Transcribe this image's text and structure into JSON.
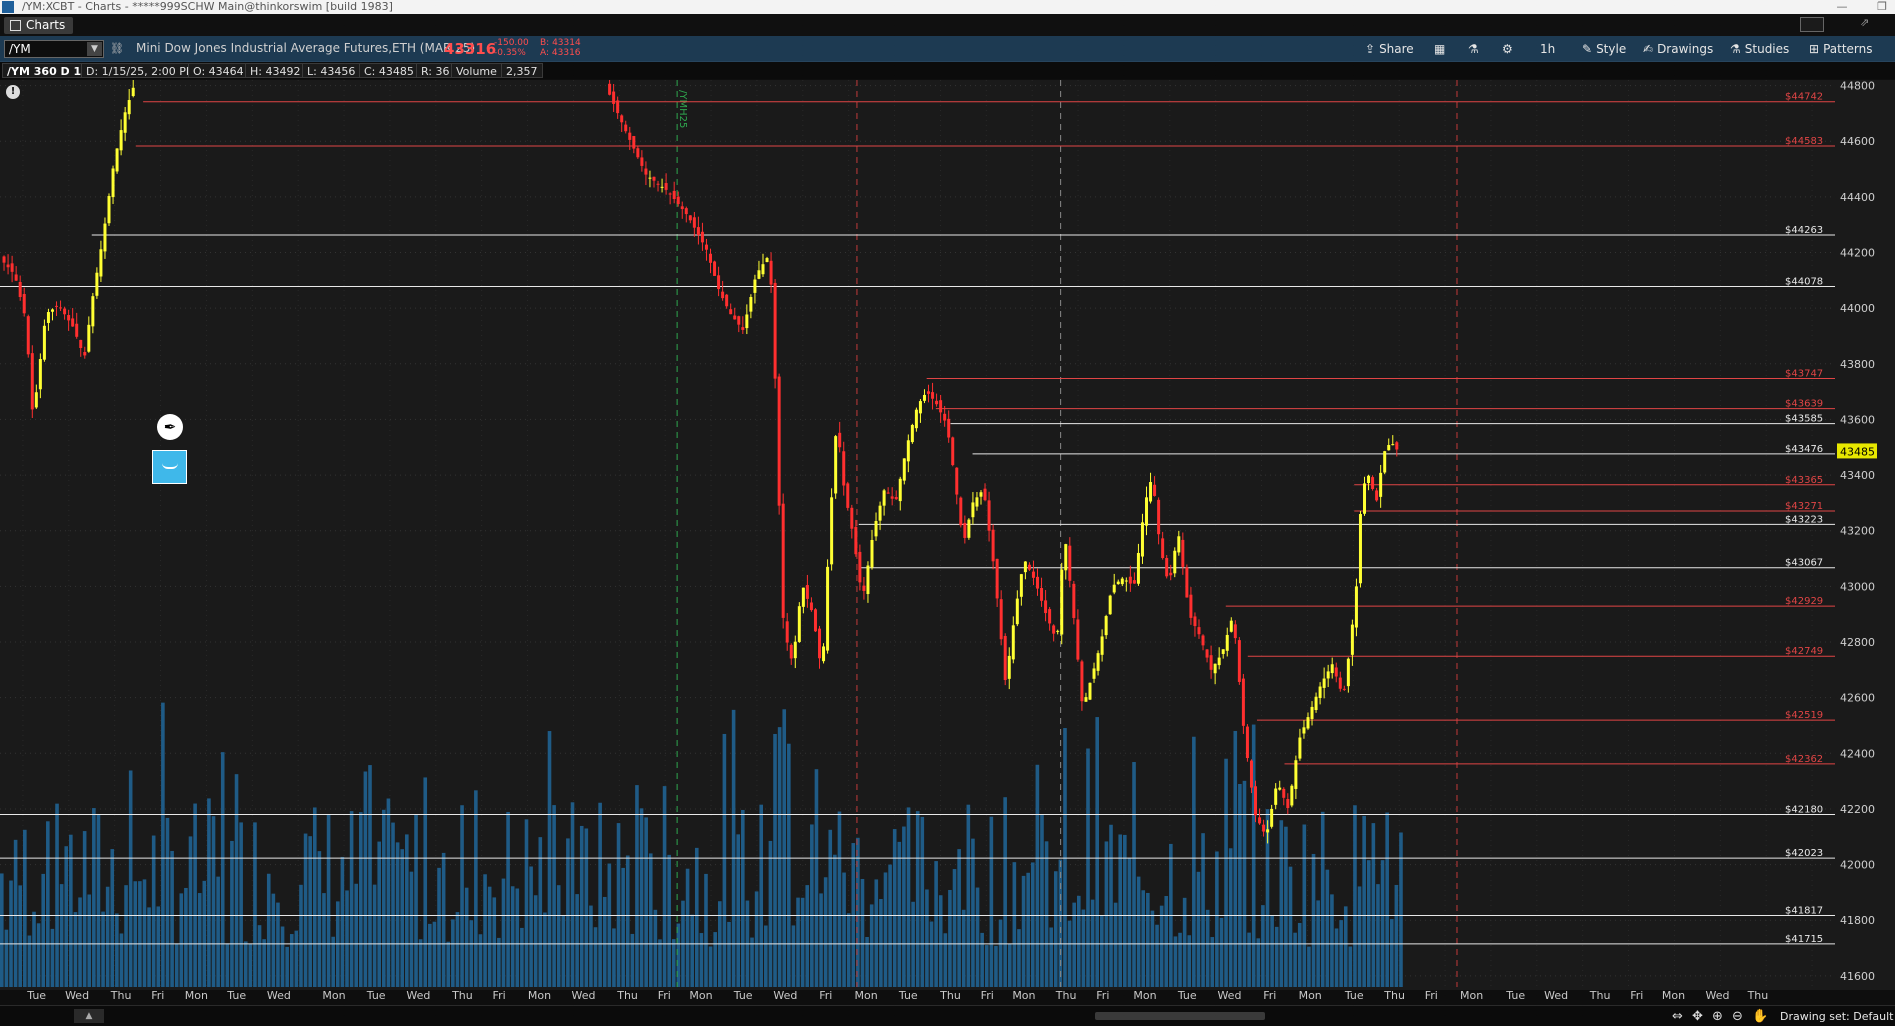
{
  "window": {
    "title": "/YM:XCBT - Charts - *****999SCHW Main@thinkorswim [build 1983]"
  },
  "tabs": [
    {
      "label": "Charts"
    }
  ],
  "toolbar": {
    "symbol": "/YM",
    "instrument_name": "Mini Dow Jones Industrial Average Futures,ETH (MAR 25)",
    "last_price": "43316",
    "net_change": "-150.00",
    "net_change_pct": "-0.35%",
    "bid": "B: 43314",
    "ask": "A: 43316",
    "buttons": [
      {
        "label": "Share",
        "icon": "share-icon"
      },
      {
        "label": "",
        "icon": "grid-icon"
      },
      {
        "label": "",
        "icon": "flask-icon"
      },
      {
        "label": "",
        "icon": "gear-icon"
      },
      {
        "label": "1h",
        "icon": ""
      },
      {
        "label": "Style",
        "icon": "style-icon"
      },
      {
        "label": "Drawings",
        "icon": "drawings-icon"
      },
      {
        "label": "Studies",
        "icon": "studies-icon"
      },
      {
        "label": "Patterns",
        "icon": "patterns-icon"
      }
    ]
  },
  "chart_header": {
    "symbol_period": "/YM 360 D 1h",
    "date": "D: 1/15/25, 2:00 PM",
    "open": "O: 43464",
    "high": "H: 43492",
    "low": "L: 43456",
    "close": "C: 43485",
    "range": "R: 36",
    "volume_label": "Volume",
    "volume_value": "2,357"
  },
  "chart_data": {
    "type": "candlestick",
    "y_range": [
      41560,
      44820
    ],
    "y_ticks": [
      44800,
      44600,
      44400,
      44200,
      44000,
      43800,
      43600,
      43400,
      43200,
      43000,
      42800,
      42600,
      42400,
      42200,
      42000,
      41800,
      41600
    ],
    "current_price_tag": "43485",
    "price_levels": [
      {
        "label": "$44742",
        "value": 44742,
        "color": "#e04545",
        "start": 0.078
      },
      {
        "label": "$44583",
        "value": 44583,
        "color": "#e04545",
        "start": 0.074
      },
      {
        "label": "$44263",
        "value": 44263,
        "color": "#e8e8e8",
        "start": 0.05
      },
      {
        "label": "$44078",
        "value": 44078,
        "color": "#e8e8e8",
        "start": 0.0
      },
      {
        "label": "$43747",
        "value": 43747,
        "color": "#e04545",
        "start": 0.505
      },
      {
        "label": "$43639",
        "value": 43639,
        "color": "#e04545",
        "start": 0.51
      },
      {
        "label": "$43585",
        "value": 43585,
        "color": "#e8e8e8",
        "start": 0.518
      },
      {
        "label": "$43476",
        "value": 43476,
        "color": "#e8e8e8",
        "start": 0.53
      },
      {
        "label": "$43365",
        "value": 43365,
        "color": "#e04545",
        "start": 0.738
      },
      {
        "label": "$43271",
        "value": 43271,
        "color": "#e04545",
        "start": 0.738
      },
      {
        "label": "$43223",
        "value": 43223,
        "color": "#e8e8e8",
        "start": 0.468
      },
      {
        "label": "$43067",
        "value": 43067,
        "color": "#e8e8e8",
        "start": 0.468
      },
      {
        "label": "$42929",
        "value": 42929,
        "color": "#e04545",
        "start": 0.668
      },
      {
        "label": "$42749",
        "value": 42749,
        "color": "#e04545",
        "start": 0.68
      },
      {
        "label": "$42519",
        "value": 42519,
        "color": "#e04545",
        "start": 0.685
      },
      {
        "label": "$42362",
        "value": 42362,
        "color": "#e04545",
        "start": 0.7
      },
      {
        "label": "$42180",
        "value": 42180,
        "color": "#e8e8e8",
        "start": 0.0
      },
      {
        "label": "$42023",
        "value": 42023,
        "color": "#e8e8e8",
        "start": 0.0
      },
      {
        "label": "$41817",
        "value": 41817,
        "color": "#e8e8e8",
        "start": 0.0
      },
      {
        "label": "$41715",
        "value": 41715,
        "color": "#e8e8e8",
        "start": 0.0
      }
    ],
    "vertical_markers": [
      {
        "pos": 0.369,
        "color": "#2fa84f",
        "label": "/YMH25"
      },
      {
        "pos": 0.467,
        "color": "#c03a3a",
        "label": ""
      },
      {
        "pos": 0.578,
        "color": "#8a8a8a",
        "label": ""
      },
      {
        "pos": 0.794,
        "color": "#c03a3a",
        "label": ""
      }
    ],
    "price_path": [
      [
        0.0,
        44180
      ],
      [
        0.008,
        44120
      ],
      [
        0.014,
        43960
      ],
      [
        0.018,
        43600
      ],
      [
        0.025,
        43980
      ],
      [
        0.032,
        44010
      ],
      [
        0.04,
        43930
      ],
      [
        0.046,
        43820
      ],
      [
        0.05,
        44020
      ],
      [
        0.056,
        44250
      ],
      [
        0.062,
        44520
      ],
      [
        0.068,
        44700
      ],
      [
        0.074,
        44820
      ],
      [
        0.33,
        44800
      ],
      [
        0.34,
        44650
      ],
      [
        0.352,
        44480
      ],
      [
        0.364,
        44420
      ],
      [
        0.375,
        44330
      ],
      [
        0.385,
        44210
      ],
      [
        0.392,
        44060
      ],
      [
        0.398,
        43980
      ],
      [
        0.405,
        43920
      ],
      [
        0.412,
        44120
      ],
      [
        0.418,
        44180
      ],
      [
        0.421,
        44050
      ],
      [
        0.424,
        43400
      ],
      [
        0.427,
        42850
      ],
      [
        0.432,
        42720
      ],
      [
        0.437,
        43010
      ],
      [
        0.443,
        42900
      ],
      [
        0.448,
        42680
      ],
      [
        0.452,
        43200
      ],
      [
        0.456,
        43600
      ],
      [
        0.46,
        43350
      ],
      [
        0.465,
        43180
      ],
      [
        0.47,
        42950
      ],
      [
        0.476,
        43200
      ],
      [
        0.482,
        43350
      ],
      [
        0.488,
        43300
      ],
      [
        0.494,
        43500
      ],
      [
        0.5,
        43650
      ],
      [
        0.505,
        43700
      ],
      [
        0.51,
        43660
      ],
      [
        0.516,
        43580
      ],
      [
        0.52,
        43400
      ],
      [
        0.525,
        43150
      ],
      [
        0.53,
        43300
      ],
      [
        0.536,
        43350
      ],
      [
        0.542,
        43050
      ],
      [
        0.548,
        42650
      ],
      [
        0.553,
        42900
      ],
      [
        0.558,
        43100
      ],
      [
        0.564,
        43020
      ],
      [
        0.57,
        42900
      ],
      [
        0.576,
        42800
      ],
      [
        0.58,
        43200
      ],
      [
        0.585,
        42900
      ],
      [
        0.59,
        42560
      ],
      [
        0.596,
        42700
      ],
      [
        0.6,
        42800
      ],
      [
        0.606,
        43000
      ],
      [
        0.612,
        43030
      ],
      [
        0.618,
        43000
      ],
      [
        0.624,
        43300
      ],
      [
        0.628,
        43400
      ],
      [
        0.632,
        43150
      ],
      [
        0.637,
        43000
      ],
      [
        0.642,
        43200
      ],
      [
        0.648,
        42900
      ],
      [
        0.654,
        42820
      ],
      [
        0.66,
        42700
      ],
      [
        0.666,
        42760
      ],
      [
        0.672,
        42900
      ],
      [
        0.678,
        42470
      ],
      [
        0.684,
        42180
      ],
      [
        0.69,
        42100
      ],
      [
        0.696,
        42300
      ],
      [
        0.702,
        42200
      ],
      [
        0.708,
        42450
      ],
      [
        0.714,
        42550
      ],
      [
        0.72,
        42650
      ],
      [
        0.726,
        42720
      ],
      [
        0.732,
        42600
      ],
      [
        0.736,
        42800
      ],
      [
        0.74,
        43050
      ],
      [
        0.742,
        43350
      ],
      [
        0.746,
        43400
      ],
      [
        0.75,
        43300
      ],
      [
        0.754,
        43480
      ],
      [
        0.758,
        43520
      ],
      [
        0.762,
        43485
      ]
    ],
    "volume_max": 1.0,
    "time_labels": [
      {
        "pos": 0.02,
        "label": "Tue"
      },
      {
        "pos": 0.042,
        "label": "Wed"
      },
      {
        "pos": 0.066,
        "label": "Thu"
      },
      {
        "pos": 0.086,
        "label": "Fri"
      },
      {
        "pos": 0.107,
        "label": "Mon"
      },
      {
        "pos": 0.129,
        "label": "Tue"
      },
      {
        "pos": 0.152,
        "label": "Wed"
      },
      {
        "pos": 0.182,
        "label": "Mon"
      },
      {
        "pos": 0.205,
        "label": "Tue"
      },
      {
        "pos": 0.228,
        "label": "Wed"
      },
      {
        "pos": 0.252,
        "label": "Thu"
      },
      {
        "pos": 0.272,
        "label": "Fri"
      },
      {
        "pos": 0.294,
        "label": "Mon"
      },
      {
        "pos": 0.318,
        "label": "Wed"
      },
      {
        "pos": 0.342,
        "label": "Thu"
      },
      {
        "pos": 0.362,
        "label": "Fri"
      },
      {
        "pos": 0.382,
        "label": "Mon"
      },
      {
        "pos": 0.405,
        "label": "Tue"
      },
      {
        "pos": 0.428,
        "label": "Wed"
      },
      {
        "pos": 0.45,
        "label": "Fri"
      },
      {
        "pos": 0.472,
        "label": "Mon"
      },
      {
        "pos": 0.495,
        "label": "Tue"
      },
      {
        "pos": 0.518,
        "label": "Thu"
      },
      {
        "pos": 0.538,
        "label": "Fri"
      },
      {
        "pos": 0.558,
        "label": "Mon"
      },
      {
        "pos": 0.581,
        "label": "Thu"
      },
      {
        "pos": 0.601,
        "label": "Fri"
      },
      {
        "pos": 0.624,
        "label": "Mon"
      },
      {
        "pos": 0.647,
        "label": "Tue"
      },
      {
        "pos": 0.67,
        "label": "Wed"
      },
      {
        "pos": 0.692,
        "label": "Fri"
      },
      {
        "pos": 0.714,
        "label": "Mon"
      },
      {
        "pos": 0.738,
        "label": "Tue"
      },
      {
        "pos": 0.76,
        "label": "Thu"
      },
      {
        "pos": 0.78,
        "label": "Fri"
      },
      {
        "pos": 0.802,
        "label": "Mon"
      },
      {
        "pos": 0.826,
        "label": "Tue"
      },
      {
        "pos": 0.848,
        "label": "Wed"
      },
      {
        "pos": 0.872,
        "label": "Thu"
      },
      {
        "pos": 0.892,
        "label": "Fri"
      },
      {
        "pos": 0.912,
        "label": "Mon"
      },
      {
        "pos": 0.936,
        "label": "Wed"
      },
      {
        "pos": 0.958,
        "label": "Thu"
      }
    ]
  },
  "status": {
    "drawing_set": "Drawing set: Default"
  }
}
